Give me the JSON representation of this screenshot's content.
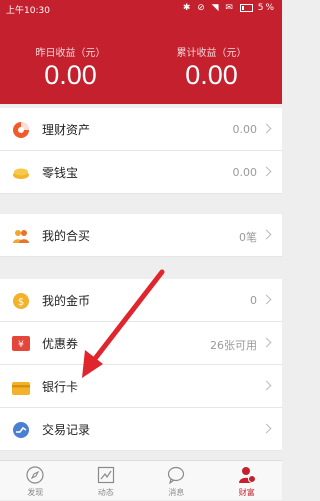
{
  "status_bar": {
    "time": "上午10:30",
    "icons": "✱ ⊘ ◥ ✉",
    "battery": "5%"
  },
  "header": {
    "yesterday_label": "昨日收益（元）",
    "yesterday_value": "0.00",
    "total_label": "累计收益（元）",
    "total_value": "0.00"
  },
  "rows": {
    "licai": {
      "label": "理财资产",
      "value": "0.00"
    },
    "lingqian": {
      "label": "零钱宝",
      "value": "0.00"
    },
    "hemai": {
      "label": "我的合买",
      "value": "0笔"
    },
    "jinbi": {
      "label": "我的金币",
      "value": "0"
    },
    "youhuiquan": {
      "label": "优惠券",
      "value": "26张可用"
    },
    "yinhangka": {
      "label": "银行卡",
      "value": ""
    },
    "jiaoyi": {
      "label": "交易记录",
      "value": ""
    }
  },
  "tabs": [
    {
      "label": "发现",
      "icon": "compass-icon",
      "active": false
    },
    {
      "label": "动态",
      "icon": "trend-icon",
      "active": false
    },
    {
      "label": "消息",
      "icon": "chat-icon",
      "active": false
    },
    {
      "label": "财富",
      "icon": "wealth-user-icon",
      "active": true
    }
  ],
  "colors": {
    "brand": "#c4202e",
    "annotation_arrow": "#e0252d"
  }
}
